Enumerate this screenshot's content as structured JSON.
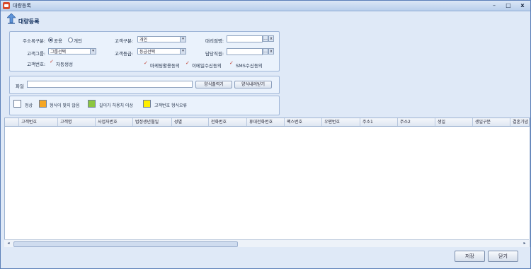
{
  "window": {
    "title": "대량등록",
    "minimize": "–",
    "maximize": "□",
    "close": "x"
  },
  "header": {
    "title": "대량등록"
  },
  "form": {
    "address_type_label": "주소록구분:",
    "radio_common": "공용",
    "radio_personal": "개인",
    "customer_type_label": "고객구분:",
    "customer_type_value": "개인",
    "agent_name_label": "대리점명:",
    "customer_group_label": "고객그룹:",
    "customer_group_value": "그룹선택",
    "customer_grade_label": "고객등급:",
    "customer_grade_value": "등급선택",
    "manager_label": "담당직원:",
    "customer_number_label": "고객번호:",
    "auto_generate": "자동생성",
    "marketing_consent": "마케팅활용동의",
    "email_consent": "이메일수신동의",
    "sms_consent": "SMS수신동의",
    "lookup_button": "...",
    "clear_button": "x"
  },
  "file": {
    "label": "파일",
    "export_template": "양식출력기",
    "import_template": "양식내려받기"
  },
  "legend": [
    {
      "label": "정상",
      "color": "#ffffff"
    },
    {
      "label": "형식이 맞지 않음",
      "color": "#f5a623"
    },
    {
      "label": "길이가 허용치 이상",
      "color": "#8cc63f"
    },
    {
      "label": "고객번호 형식오류",
      "color": "#ffef00"
    }
  ],
  "grid": {
    "columns": [
      "고객번호",
      "고객명",
      "사업자번호",
      "법정생년월일",
      "성별",
      "전화번호",
      "휴대전화번호",
      "팩스번호",
      "우편번호",
      "주소1",
      "주소2",
      "생일",
      "생일구분",
      "결혼기념"
    ]
  },
  "footer": {
    "save": "저장",
    "close": "닫기"
  }
}
